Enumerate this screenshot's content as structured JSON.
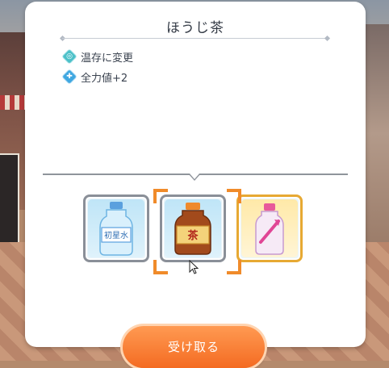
{
  "dialog": {
    "title": "ほうじ茶",
    "effects": [
      {
        "icon": "stamina-icon",
        "text": "温存に変更",
        "glyph": "◎"
      },
      {
        "icon": "plus-icon",
        "text": "全力値+2",
        "glyph": "✚"
      }
    ],
    "items": [
      {
        "name": "water-bottle",
        "label": "初星水",
        "selected": false,
        "frame": "silver"
      },
      {
        "name": "houjicha-bottle",
        "label": "ほうじ茶",
        "selected": true,
        "frame": "silver"
      },
      {
        "name": "pink-drink-bottle",
        "label": "",
        "selected": false,
        "frame": "gold"
      }
    ],
    "receive_button_label": "受け取る"
  },
  "colors": {
    "accent_orange": "#f46b22",
    "selection_bracket": "#f08b2a",
    "gold_frame": "#e7a933"
  }
}
